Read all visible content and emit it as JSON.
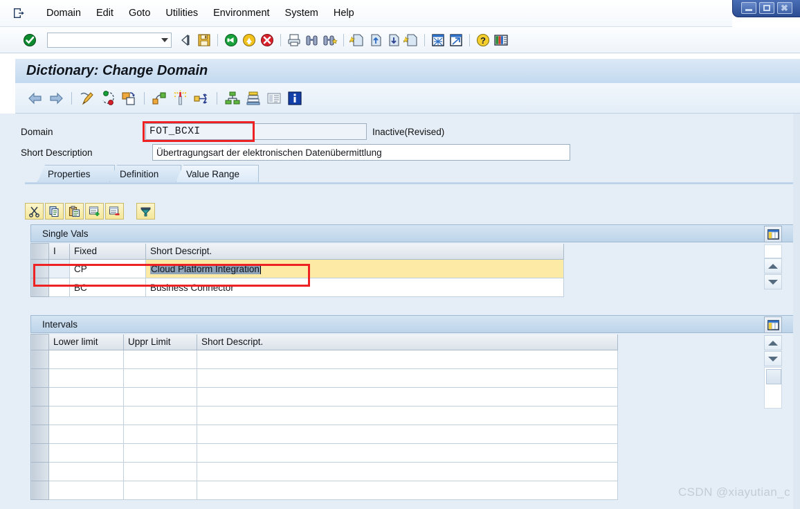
{
  "window": {
    "controls": [
      {
        "name": "minimize",
        "glyph": "minimize-icon"
      },
      {
        "name": "maximize",
        "glyph": "maximize-icon"
      },
      {
        "name": "close",
        "glyph": "close-icon"
      }
    ]
  },
  "menubar": {
    "logo_icon": "sap-session-icon",
    "items": [
      {
        "label": "Domain",
        "accel": ""
      },
      {
        "label": "Edit",
        "accel": "E"
      },
      {
        "label": "Goto",
        "accel": "G"
      },
      {
        "label": "Utilities",
        "accel": "U"
      },
      {
        "label": "Environment",
        "accel": "n"
      },
      {
        "label": "System",
        "accel": "y"
      },
      {
        "label": "Help",
        "accel": "H"
      }
    ]
  },
  "toolbar": {
    "okcode_value": "",
    "okcode_placeholder": "",
    "enter_icon": "enter-check-icon",
    "dropdown_icon": "chevron-down-icon",
    "icons": [
      "back-icon",
      "save-icon",
      "back-green-icon",
      "exit-yellow-icon",
      "cancel-red-icon",
      "print-icon",
      "find-icon",
      "find-next-icon",
      "first-page-icon",
      "previous-page-icon",
      "next-page-icon",
      "last-page-icon",
      "new-session-icon",
      "create-shortcut-icon",
      "help-icon",
      "customize-layout-icon"
    ]
  },
  "screen": {
    "title": "Dictionary: Change Domain"
  },
  "apptoolbar": {
    "icons": [
      "back-arrow-icon",
      "forward-arrow-icon",
      "display-change-icon",
      "activate-icon",
      "copy-object-icon",
      "where-used-list-icon",
      "generate-icon",
      "navigate-icon",
      "hierarchy-icon",
      "stack-icon",
      "documentation-icon",
      "info-icon"
    ]
  },
  "form": {
    "domain_label": "Domain",
    "domain_value": "FOT_BCXI",
    "domain_status": "Inactive(Revised)",
    "short_description_label": "Short Description",
    "short_description_value": "Übertragungsart der elektronischen Datenübermittlung"
  },
  "tabs": [
    {
      "label": "Properties",
      "active": false
    },
    {
      "label": "Definition",
      "active": false
    },
    {
      "label": "Value Range",
      "active": true
    }
  ],
  "panel_toolbar": {
    "icons": [
      "cut-icon",
      "copy-icon",
      "paste-icon",
      "insert-row-icon",
      "delete-row-icon",
      "filter-icon"
    ]
  },
  "single_vals": {
    "band_title": "Single Vals",
    "columns": [
      "",
      "I",
      "Fixed",
      "Short Descript."
    ],
    "rows": [
      {
        "selector": "",
        "i": "",
        "fixed": "CP",
        "short_descript": "Cloud Platform Integration",
        "state": "editing",
        "selected_text": true
      },
      {
        "selector": "",
        "i": "",
        "fixed": "BC",
        "short_descript": "Business Connector",
        "state": "normal",
        "selected_text": false
      }
    ],
    "hscroll": {
      "left_icon": "scroll-left-icon",
      "right_icon": "scroll-right-icon"
    },
    "vscroll": {
      "config_icon": "table-settings-icon",
      "up_icon": "scroll-up-icon",
      "down_icon": "scroll-down-icon"
    }
  },
  "intervals": {
    "band_title": "Intervals",
    "columns": [
      "",
      "Lower limit",
      "Uppr Limit",
      "Short Descript."
    ],
    "rows": [
      {
        "lower": "",
        "upper": "",
        "short_descript": ""
      },
      {
        "lower": "",
        "upper": "",
        "short_descript": ""
      },
      {
        "lower": "",
        "upper": "",
        "short_descript": ""
      },
      {
        "lower": "",
        "upper": "",
        "short_descript": ""
      },
      {
        "lower": "",
        "upper": "",
        "short_descript": ""
      },
      {
        "lower": "",
        "upper": "",
        "short_descript": ""
      },
      {
        "lower": "",
        "upper": "",
        "short_descript": ""
      },
      {
        "lower": "",
        "upper": "",
        "short_descript": ""
      }
    ],
    "vscroll": {
      "config_icon": "table-settings-icon",
      "up_icon": "scroll-up-icon",
      "down_icon": "scroll-down-icon",
      "thumb": "scroll-thumb"
    }
  },
  "annotations": {
    "domain_highlight": "red-box-domain-field",
    "cp_row_highlight": "red-box-cp-row"
  },
  "watermark": {
    "text": "CSDN @xiayutian_c"
  },
  "colors": {
    "accent_blue": "#2b4d92",
    "panel_bg": "#e5eef7",
    "annotation_red": "#ee2222",
    "edit_yellow": "#fdeba5",
    "selection_gray": "#8fa3b8"
  }
}
